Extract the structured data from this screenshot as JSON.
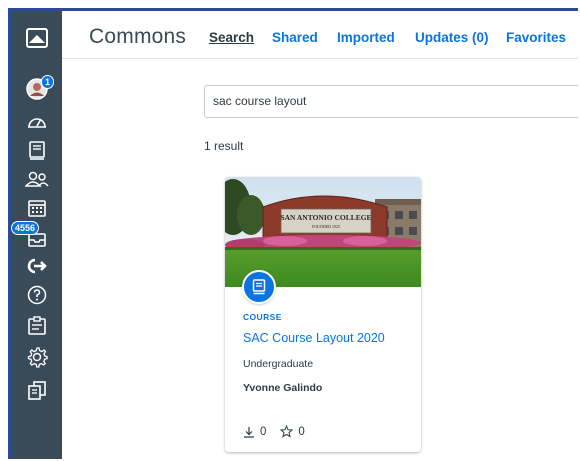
{
  "app": {
    "title": "Commons"
  },
  "nav": {
    "tabs": [
      {
        "label": "Search",
        "active": true
      },
      {
        "label": "Shared",
        "active": false
      },
      {
        "label": "Imported",
        "active": false
      },
      {
        "label": "Updates (0)",
        "active": false
      },
      {
        "label": "Favorites",
        "active": false
      }
    ]
  },
  "sidebar": {
    "items": [
      {
        "icon": "logo-icon"
      },
      {
        "icon": "avatar-icon",
        "badge": "1"
      },
      {
        "icon": "dashboard-icon"
      },
      {
        "icon": "courses-icon"
      },
      {
        "icon": "groups-icon"
      },
      {
        "icon": "calendar-icon"
      },
      {
        "icon": "inbox-icon",
        "badge": "4556"
      },
      {
        "icon": "commons-icon"
      },
      {
        "icon": "help-icon"
      },
      {
        "icon": "notes-icon"
      },
      {
        "icon": "settings-icon"
      },
      {
        "icon": "copy-icon"
      }
    ]
  },
  "search": {
    "value": "sac course layout"
  },
  "results": {
    "count_text": "1 result"
  },
  "card": {
    "type": "COURSE",
    "title": "SAC Course Layout 2020",
    "subtitle": "Undergraduate",
    "author": "Yvonne Galindo",
    "downloads": "0",
    "favorites": "0",
    "image_sign_text": "SAN ANTONIO COLLEGE",
    "image_sign_subtext": "FOUNDED 1925"
  },
  "colors": {
    "sidebar": "#394b58",
    "accent": "#0b74de",
    "frame": "#2c4a9a"
  }
}
